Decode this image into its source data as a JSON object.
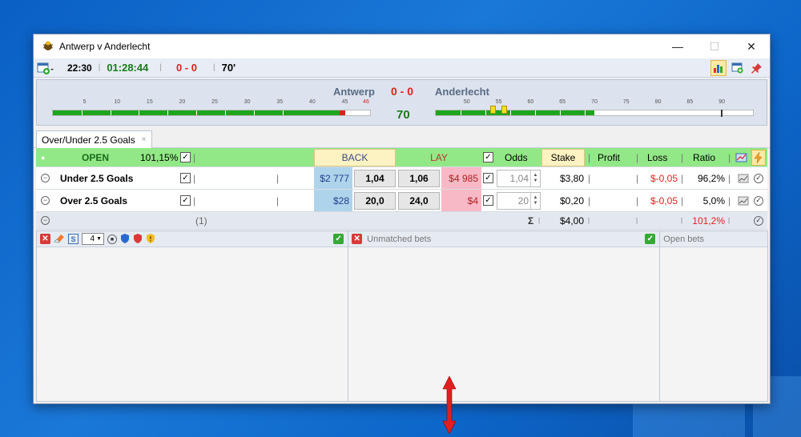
{
  "window": {
    "title": "Antwerp v Anderlecht",
    "minimize": "—",
    "maximize": "☐",
    "close": "✕"
  },
  "toolbar": {
    "kickoff": "22:30",
    "clock": "01:28:44",
    "score": "0 - 0",
    "minute": "70'"
  },
  "match": {
    "home": "Antwerp",
    "score": "0 - 0",
    "away": "Anderlecht",
    "minute": "70",
    "first_half_ticks": [
      "5",
      "10",
      "15",
      "20",
      "25",
      "30",
      "35",
      "40",
      "45",
      "46"
    ],
    "second_half_ticks": [
      "50",
      "55",
      "60",
      "65",
      "70",
      "75",
      "80",
      "85",
      "90"
    ],
    "first_half_progress": 1.0,
    "second_half_progress": 0.5
  },
  "tab": {
    "label": "Over/Under 2.5 Goals",
    "close": "×"
  },
  "header": {
    "status": "OPEN",
    "book_pct": "101,15%",
    "back": "BACK",
    "lay": "LAY",
    "odds": "Odds",
    "stake": "Stake",
    "profit": "Profit",
    "loss": "Loss",
    "ratio": "Ratio"
  },
  "runners": [
    {
      "name": "Under 2.5 Goals",
      "back_amount": "$2 777",
      "back_price": "1,04",
      "lay_price": "1,06",
      "lay_amount": "$4 985",
      "odds": "1,04",
      "stake": "$3,80",
      "loss": "$-0,05",
      "ratio": "96,2%"
    },
    {
      "name": "Over 2.5 Goals",
      "back_amount": "$28",
      "back_price": "20,0",
      "lay_price": "24,0",
      "lay_amount": "$4",
      "odds": "20",
      "stake": "$0,20",
      "loss": "$-0,05",
      "ratio": "5,0%"
    }
  ],
  "totals": {
    "count": "(1)",
    "sigma": "Σ",
    "stake": "$4,00",
    "ratio": "101,2%"
  },
  "panels": {
    "left_qty": "4",
    "unmatched_label": "Unmatched bets",
    "open_label": "Open bets"
  },
  "colors": {
    "accent_green": "#1ea51e",
    "header_green": "#92e886",
    "back_blue": "#aed4ec",
    "lay_pink": "#f7b9c6",
    "loss_red": "#e02020"
  }
}
